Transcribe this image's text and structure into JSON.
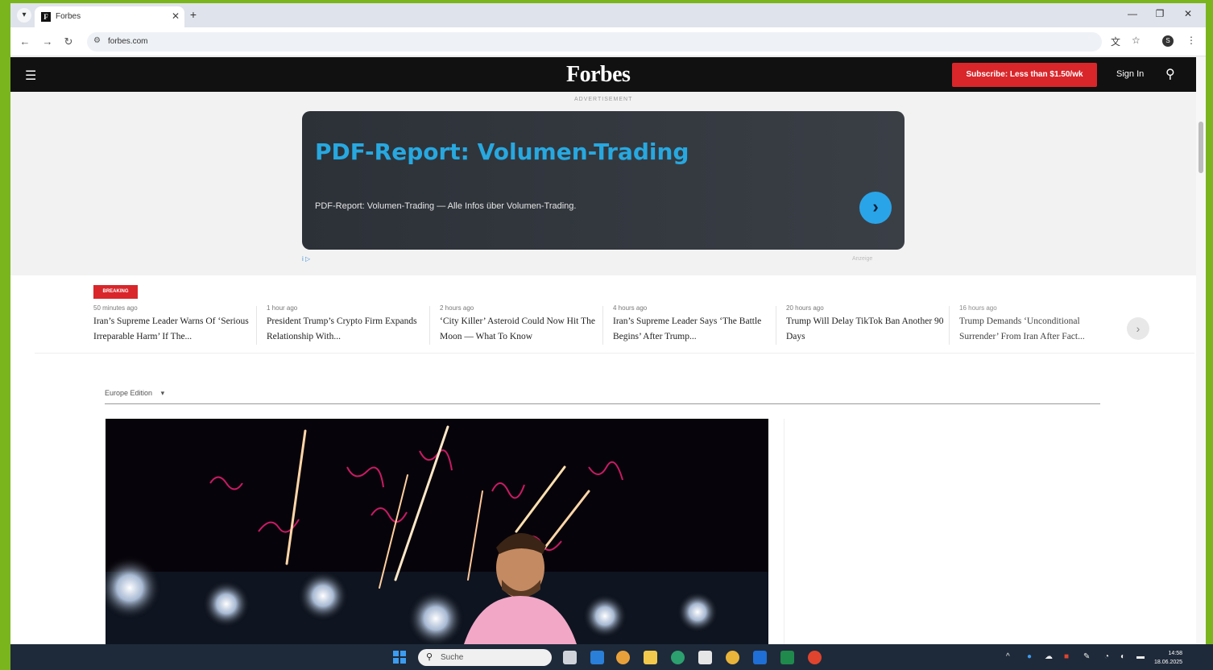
{
  "browser": {
    "tab_title": "Forbes",
    "tab_favicon": "F",
    "url": "forbes.com",
    "new_tab": "+",
    "profile_initial": "S"
  },
  "header": {
    "logo": "Forbes",
    "subscribe": "Subscribe: Less than $1.50/wk",
    "signin": "Sign In"
  },
  "ad": {
    "label": "ADVERTISEMENT",
    "title": "PDF-Report: Volumen-Trading",
    "description": "PDF-Report: Volumen-Trading — Alle Infos über Volumen-Trading.",
    "foot_right": "Anzeige"
  },
  "breaking": {
    "badge": "BREAKING",
    "items": [
      {
        "time": "50 minutes ago",
        "headline": "Iran’s Supreme Leader Warns Of ‘Serious Irreparable Harm’ If The..."
      },
      {
        "time": "1 hour ago",
        "headline": "President Trump’s Crypto Firm Expands Relationship With..."
      },
      {
        "time": "2 hours ago",
        "headline": "‘City Killer’ Asteroid Could Now Hit The Moon — What To Know"
      },
      {
        "time": "4 hours ago",
        "headline": "Iran’s Supreme Leader Says ‘The Battle Begins’ After Trump..."
      },
      {
        "time": "20 hours ago",
        "headline": "Trump Will Delay TikTok Ban Another 90 Days"
      },
      {
        "time": "16 hours ago",
        "headline": "Trump Demands ‘Unconditional Surrender’ From Iran After Fact..."
      }
    ]
  },
  "edition": {
    "label": "Europe Edition"
  },
  "taskbar": {
    "search_placeholder": "Suche",
    "time": "14:58",
    "date": "18.06.2025"
  }
}
